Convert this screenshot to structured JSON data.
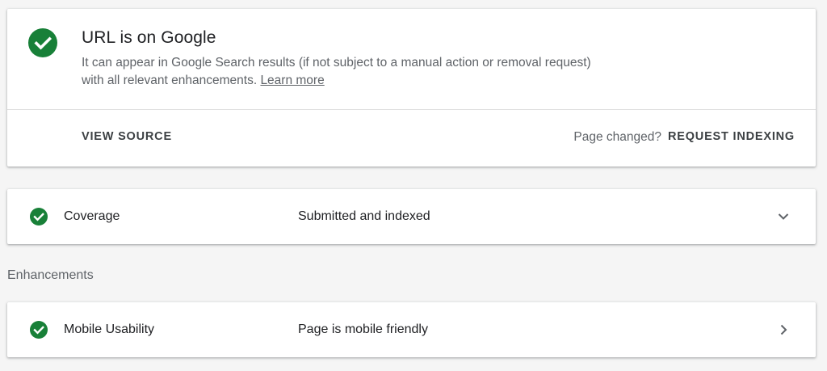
{
  "status": {
    "title": "URL is on Google",
    "description": "It can appear in Google Search results (if not subject to a manual action or removal request) with all relevant enhancements.",
    "learn_more": "Learn more",
    "view_source": "VIEW SOURCE",
    "page_changed": "Page changed?",
    "request_indexing": "REQUEST INDEXING"
  },
  "coverage": {
    "label": "Coverage",
    "value": "Submitted and indexed",
    "icon": "chevron-down-icon"
  },
  "enhancements": {
    "heading": "Enhancements",
    "items": [
      {
        "label": "Mobile Usability",
        "value": "Page is mobile friendly",
        "icon": "chevron-right-icon"
      }
    ]
  },
  "colors": {
    "success_green": "#188038",
    "text_primary": "#202124",
    "text_secondary": "#5f6368",
    "background": "#f5f5f5"
  }
}
